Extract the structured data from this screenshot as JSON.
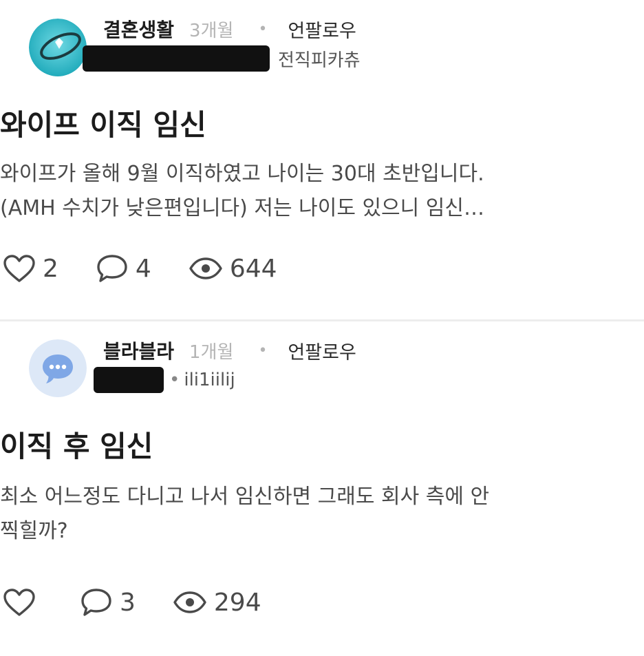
{
  "posts": [
    {
      "channel": "결혼생활",
      "time": "3개월",
      "follow_label": "언팔로우",
      "company": "전직피카츄",
      "title": "와이프 이직 임신",
      "excerpt_line1": "와이프가 올해 9월 이직하였고 나이는 30대 초반입니다.",
      "excerpt_line2": "(AMH 수치가 낮은편입니다)  저는 나이도 있으니 임신…",
      "likes": "2",
      "comments": "4",
      "views": "644",
      "avatar_icon": "ring-icon"
    },
    {
      "channel": "블라블라",
      "time": "1개월",
      "follow_label": "언팔로우",
      "company": "ili1iilij",
      "title": "이직 후 임신",
      "excerpt_line1": "최소 어느정도 다니고 나서 임신하면 그래도 회사 측에 안",
      "excerpt_line2": "찍힐까?",
      "likes": "",
      "comments": "3",
      "views": "294",
      "avatar_icon": "chat-bubble-icon"
    }
  ],
  "colors": {
    "accent_teal": "#2fb6c6",
    "bubble_blue": "#7fa7e6",
    "bubble_bg": "#dde8f7"
  }
}
